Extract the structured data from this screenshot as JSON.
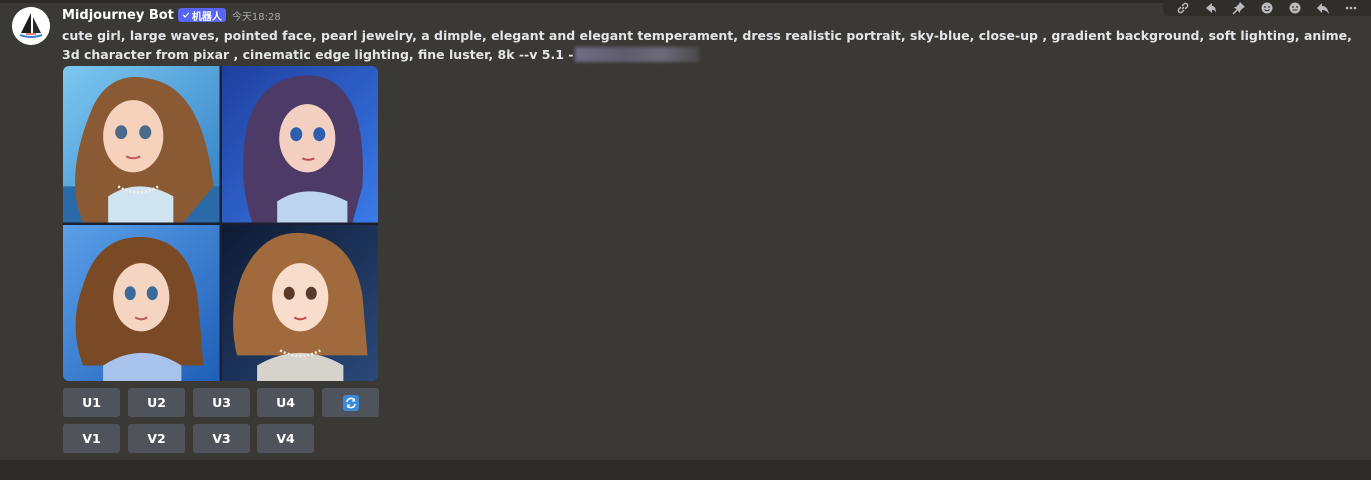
{
  "message": {
    "author": "Midjourney Bot",
    "bot_badge": "机器人",
    "timestamp": "今天18:28",
    "prompt": "cute girl, large waves, pointed face, pearl jewelry, a dimple, elegant and elegant temperament, dress realistic portrait, sky-blue, close-up , gradient background, soft lighting, anime, 3d character from pixar , cinematic edge lighting, fine luster, 8k --v 5.1 -"
  },
  "image_grid": {
    "images": [
      {
        "description": "girl-1",
        "bg": "#5cb4e8",
        "hair": "#8a5a34"
      },
      {
        "description": "girl-2",
        "bg": "#2a5fd0",
        "hair": "#4d3a66"
      },
      {
        "description": "girl-3",
        "bg": "#3c8ad8",
        "hair": "#7a4a26"
      },
      {
        "description": "girl-4",
        "bg": "#1a2540",
        "hair": "#a06a3c"
      }
    ]
  },
  "buttons": {
    "upscale": [
      "U1",
      "U2",
      "U3",
      "U4"
    ],
    "variation": [
      "V1",
      "V2",
      "V3",
      "V4"
    ],
    "reroll_icon": "refresh-icon"
  },
  "toolbar": {
    "icons": [
      "link-icon",
      "share-icon",
      "pin-icon",
      "add-reaction-icon",
      "emoji-icon",
      "reply-icon",
      "more-icon"
    ]
  },
  "colors": {
    "background": "#3b3935",
    "button": "#4f545c",
    "badge": "#5865f2",
    "reroll_accent": "#3b8ad8"
  }
}
